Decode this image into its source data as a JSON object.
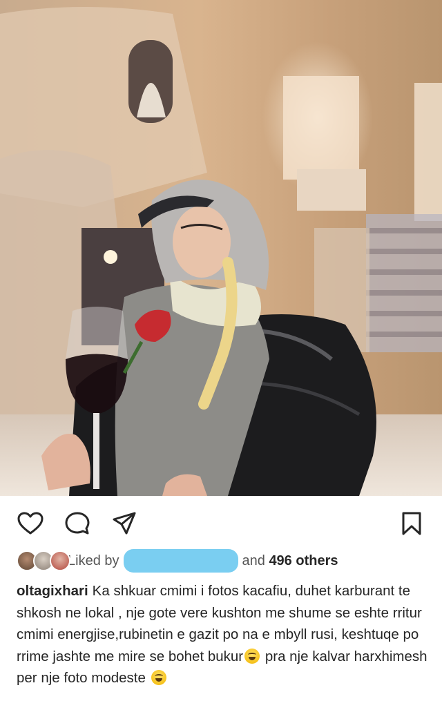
{
  "post": {
    "photo_description_icon": "post-photo",
    "likes": {
      "liked_by_label": "Liked by",
      "connector": "and",
      "others": "496 others"
    },
    "caption": {
      "username": "oltagixhari",
      "line1": "Ka shkuar cmimi i fotos kacafiu, duhet karburant te shkosh ne lokal , nje gote vere kushton me shume se eshte rritur cmimi energjise,rubinetin e gazit po na e mbyll rusi, keshtuqe po rrime jashte me mire se bohet bukur",
      "line2": " pra nje kalvar harxhimesh per nje foto modeste "
    },
    "icons": {
      "like": "heart-icon",
      "comment": "comment-icon",
      "share": "share-icon",
      "save": "bookmark-icon",
      "emoji": "laughing-emoji-icon"
    },
    "colors": {
      "redaction": "#63c5ef",
      "text": "#262626"
    }
  }
}
